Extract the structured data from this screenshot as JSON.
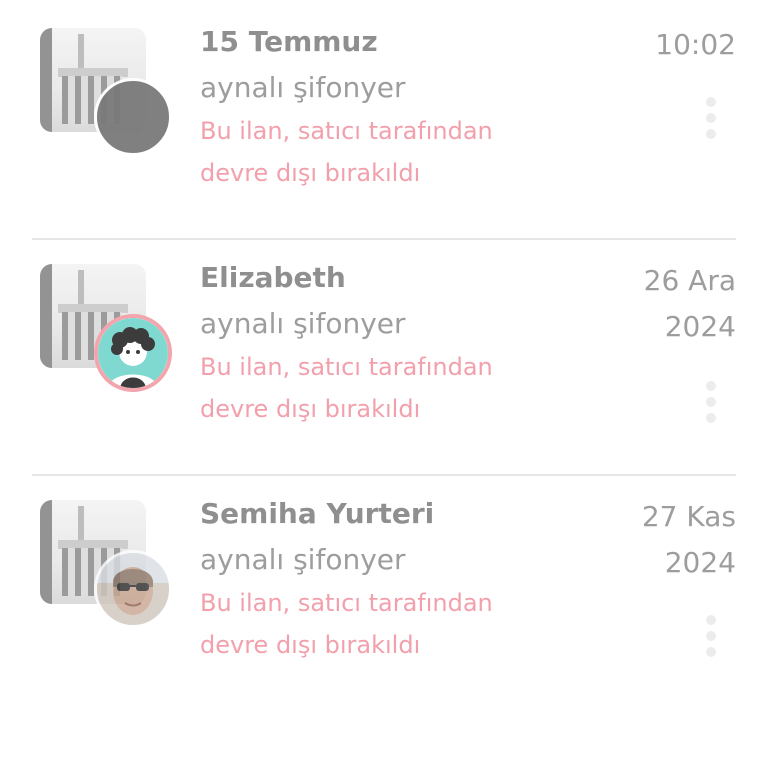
{
  "conversations": [
    {
      "name": "15 Temmuz",
      "date": "10:02",
      "listing": "aynalı şifonyer",
      "status": "Bu ilan, satıcı tarafından devre dışı bırakıldı",
      "avatar": "gray-circle"
    },
    {
      "name": "Elizabeth",
      "date": "26 Ara 2024",
      "listing": "aynalı şifonyer",
      "status": "Bu ilan, satıcı tarafından devre dışı bırakıldı",
      "avatar": "illustrated-user"
    },
    {
      "name": "Semiha Yurteri",
      "date": "27 Kas 2024",
      "listing": "aynalı şifonyer",
      "status": "Bu ilan, satıcı tarafından devre dışı bırakıldı",
      "avatar": "photo"
    }
  ],
  "colors": {
    "status_text": "#f2a0ac",
    "name_text": "#8f8f8f",
    "secondary_text": "#9d9d9d",
    "avatar_ring": "#f2a5ad",
    "divider": "#e6e6e6"
  },
  "icons": {
    "menu": "vertical-dots-icon",
    "thumbnail": "listing-thumbnail"
  }
}
